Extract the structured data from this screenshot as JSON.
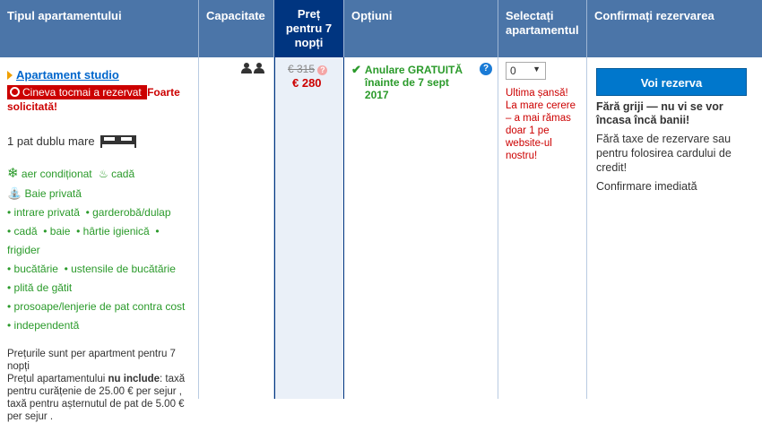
{
  "headers": {
    "room_type": "Tipul apartamentului",
    "capacity": "Capacitate",
    "price": [
      "Preț",
      "pentru 7",
      "nopți"
    ],
    "options": "Opțiuni",
    "select": [
      "Selectați",
      "apartamentul"
    ],
    "confirm": "Confirmați rezervarea"
  },
  "room": {
    "name": "Apartament studio",
    "alert_text": "Cineva tocmai a rezervat",
    "alert_strong": "Foarte solicitată!",
    "bed": "1 pat dublu mare",
    "facilities_icons": [
      {
        "label": "aer condiționat",
        "icon": "snowflake-icon"
      },
      {
        "label": "cadă",
        "icon": "bathtub-icon"
      }
    ],
    "bath": "Baie privată",
    "amenity_rows": [
      [
        "intrare privată",
        "garderobă/dulap"
      ],
      [
        "cadă",
        "baie",
        "hârtie igienică",
        "frigider"
      ],
      [
        "bucătărie",
        "ustensile de bucătărie"
      ],
      [
        "plită de gătit"
      ],
      [
        "prosoape/lenjerie de pat contra cost"
      ],
      [
        "independentă"
      ]
    ],
    "prices_note": "Prețurile sunt per apartment pentru 7 nopți",
    "not_included_prefix": "Prețul apartamentului",
    "not_included_bold": "nu include",
    "not_included_rest": ": taxă pentru curățenie de 25.00 € per sejur , taxă pentru așternutul de pat de 5.00 € per sejur ."
  },
  "price": {
    "old": "€ 315",
    "new": "€ 280"
  },
  "options": {
    "cancel": "Anulare GRATUITĂ înainte de 7 sept 2017"
  },
  "select": {
    "value": "0",
    "last_chance": "Ultima șansă! La mare cerere – a mai rămas doar 1 pe website-ul nostru!"
  },
  "confirm": {
    "button": "Voi rezerva",
    "no_worry": "Fără griji — nu vi se vor încasa încă banii!",
    "no_fees": "Fără taxe de rezervare sau pentru folosirea cardului de credit!",
    "instant": "Confirmare imediată"
  }
}
